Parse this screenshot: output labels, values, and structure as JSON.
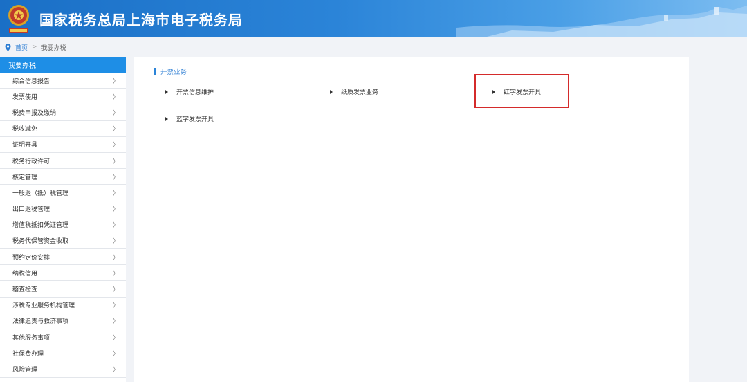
{
  "header": {
    "title": "国家税务总局上海市电子税务局",
    "accent": "#1a6fc6"
  },
  "breadcrumb": {
    "home": "首页",
    "separator": ">",
    "current": "我要办税"
  },
  "sidebar": {
    "title": "我要办税",
    "chevron": "〉",
    "items": [
      {
        "label": "综合信息报告"
      },
      {
        "label": "发票使用"
      },
      {
        "label": "税费申报及缴纳"
      },
      {
        "label": "税收减免"
      },
      {
        "label": "证明开具"
      },
      {
        "label": "税务行政许可"
      },
      {
        "label": "核定管理"
      },
      {
        "label": "一般退（抵）税管理"
      },
      {
        "label": "出口退税管理"
      },
      {
        "label": "增值税抵扣凭证管理"
      },
      {
        "label": "税务代保管资金收取"
      },
      {
        "label": "预约定价安排"
      },
      {
        "label": "纳税信用"
      },
      {
        "label": "稽查检查"
      },
      {
        "label": "涉税专业服务机构管理"
      },
      {
        "label": "法律追责与救济事项"
      },
      {
        "label": "其他服务事项"
      },
      {
        "label": "社保费办理"
      },
      {
        "label": "风险管理"
      }
    ]
  },
  "main": {
    "section_title": "开票业务",
    "links": [
      {
        "label": "开票信息维护"
      },
      {
        "label": "纸质发票业务"
      },
      {
        "label": "红字发票开具"
      },
      {
        "label": "蓝字发票开具"
      }
    ],
    "highlight_color": "#d42b2b"
  }
}
